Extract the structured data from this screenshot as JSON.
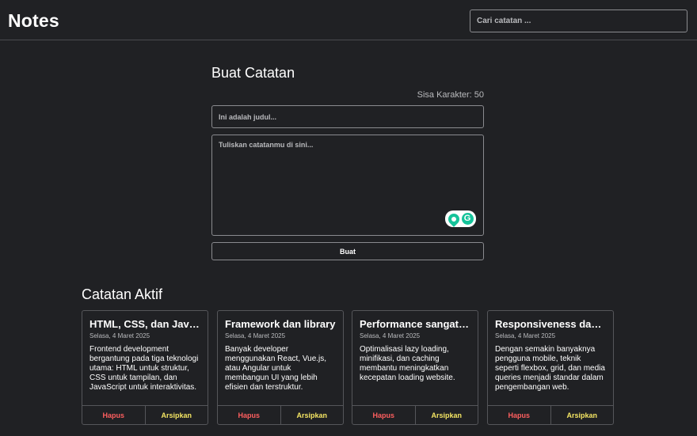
{
  "header": {
    "brand": "Notes",
    "search_placeholder": "Cari catatan ..."
  },
  "create": {
    "title": "Buat Catatan",
    "char_remaining": "Sisa Karakter: 50",
    "title_placeholder": "Ini adalah judul...",
    "body_placeholder": "Tuliskan catatanmu di sini...",
    "submit_label": "Buat",
    "ext_icon_letter": "G"
  },
  "active": {
    "title": "Catatan Aktif",
    "notes": [
      {
        "title": "HTML, CSS, dan JavaScript",
        "date": "Selasa, 4 Maret 2025",
        "body": "Frontend development bergantung pada tiga teknologi utama: HTML untuk struktur, CSS untuk tampilan, dan JavaScript untuk interaktivitas.",
        "delete_label": "Hapus",
        "archive_label": "Arsipkan"
      },
      {
        "title": "Framework dan library",
        "date": "Selasa, 4 Maret 2025",
        "body": "Banyak developer menggunakan React, Vue.js, atau Angular untuk membangun UI yang lebih efisien dan terstruktur.",
        "delete_label": "Hapus",
        "archive_label": "Arsipkan"
      },
      {
        "title": "Performance sangat penting",
        "date": "Selasa, 4 Maret 2025",
        "body": "Optimalisasi lazy loading, minifikasi, dan caching membantu meningkatkan kecepatan loading website.",
        "delete_label": "Hapus",
        "archive_label": "Arsipkan"
      },
      {
        "title": "Responsiveness dan mobile",
        "date": "Selasa, 4 Maret 2025",
        "body": "Dengan semakin banyaknya pengguna mobile, teknik seperti flexbox, grid, dan media queries menjadi standar dalam pengembangan web.",
        "delete_label": "Hapus",
        "archive_label": "Arsipkan"
      }
    ]
  },
  "colors": {
    "background": "#202124",
    "border": "#8a8b8f",
    "delete": "#ff5f5f",
    "archive": "#f5e663",
    "ext_accent": "#15c39a"
  }
}
